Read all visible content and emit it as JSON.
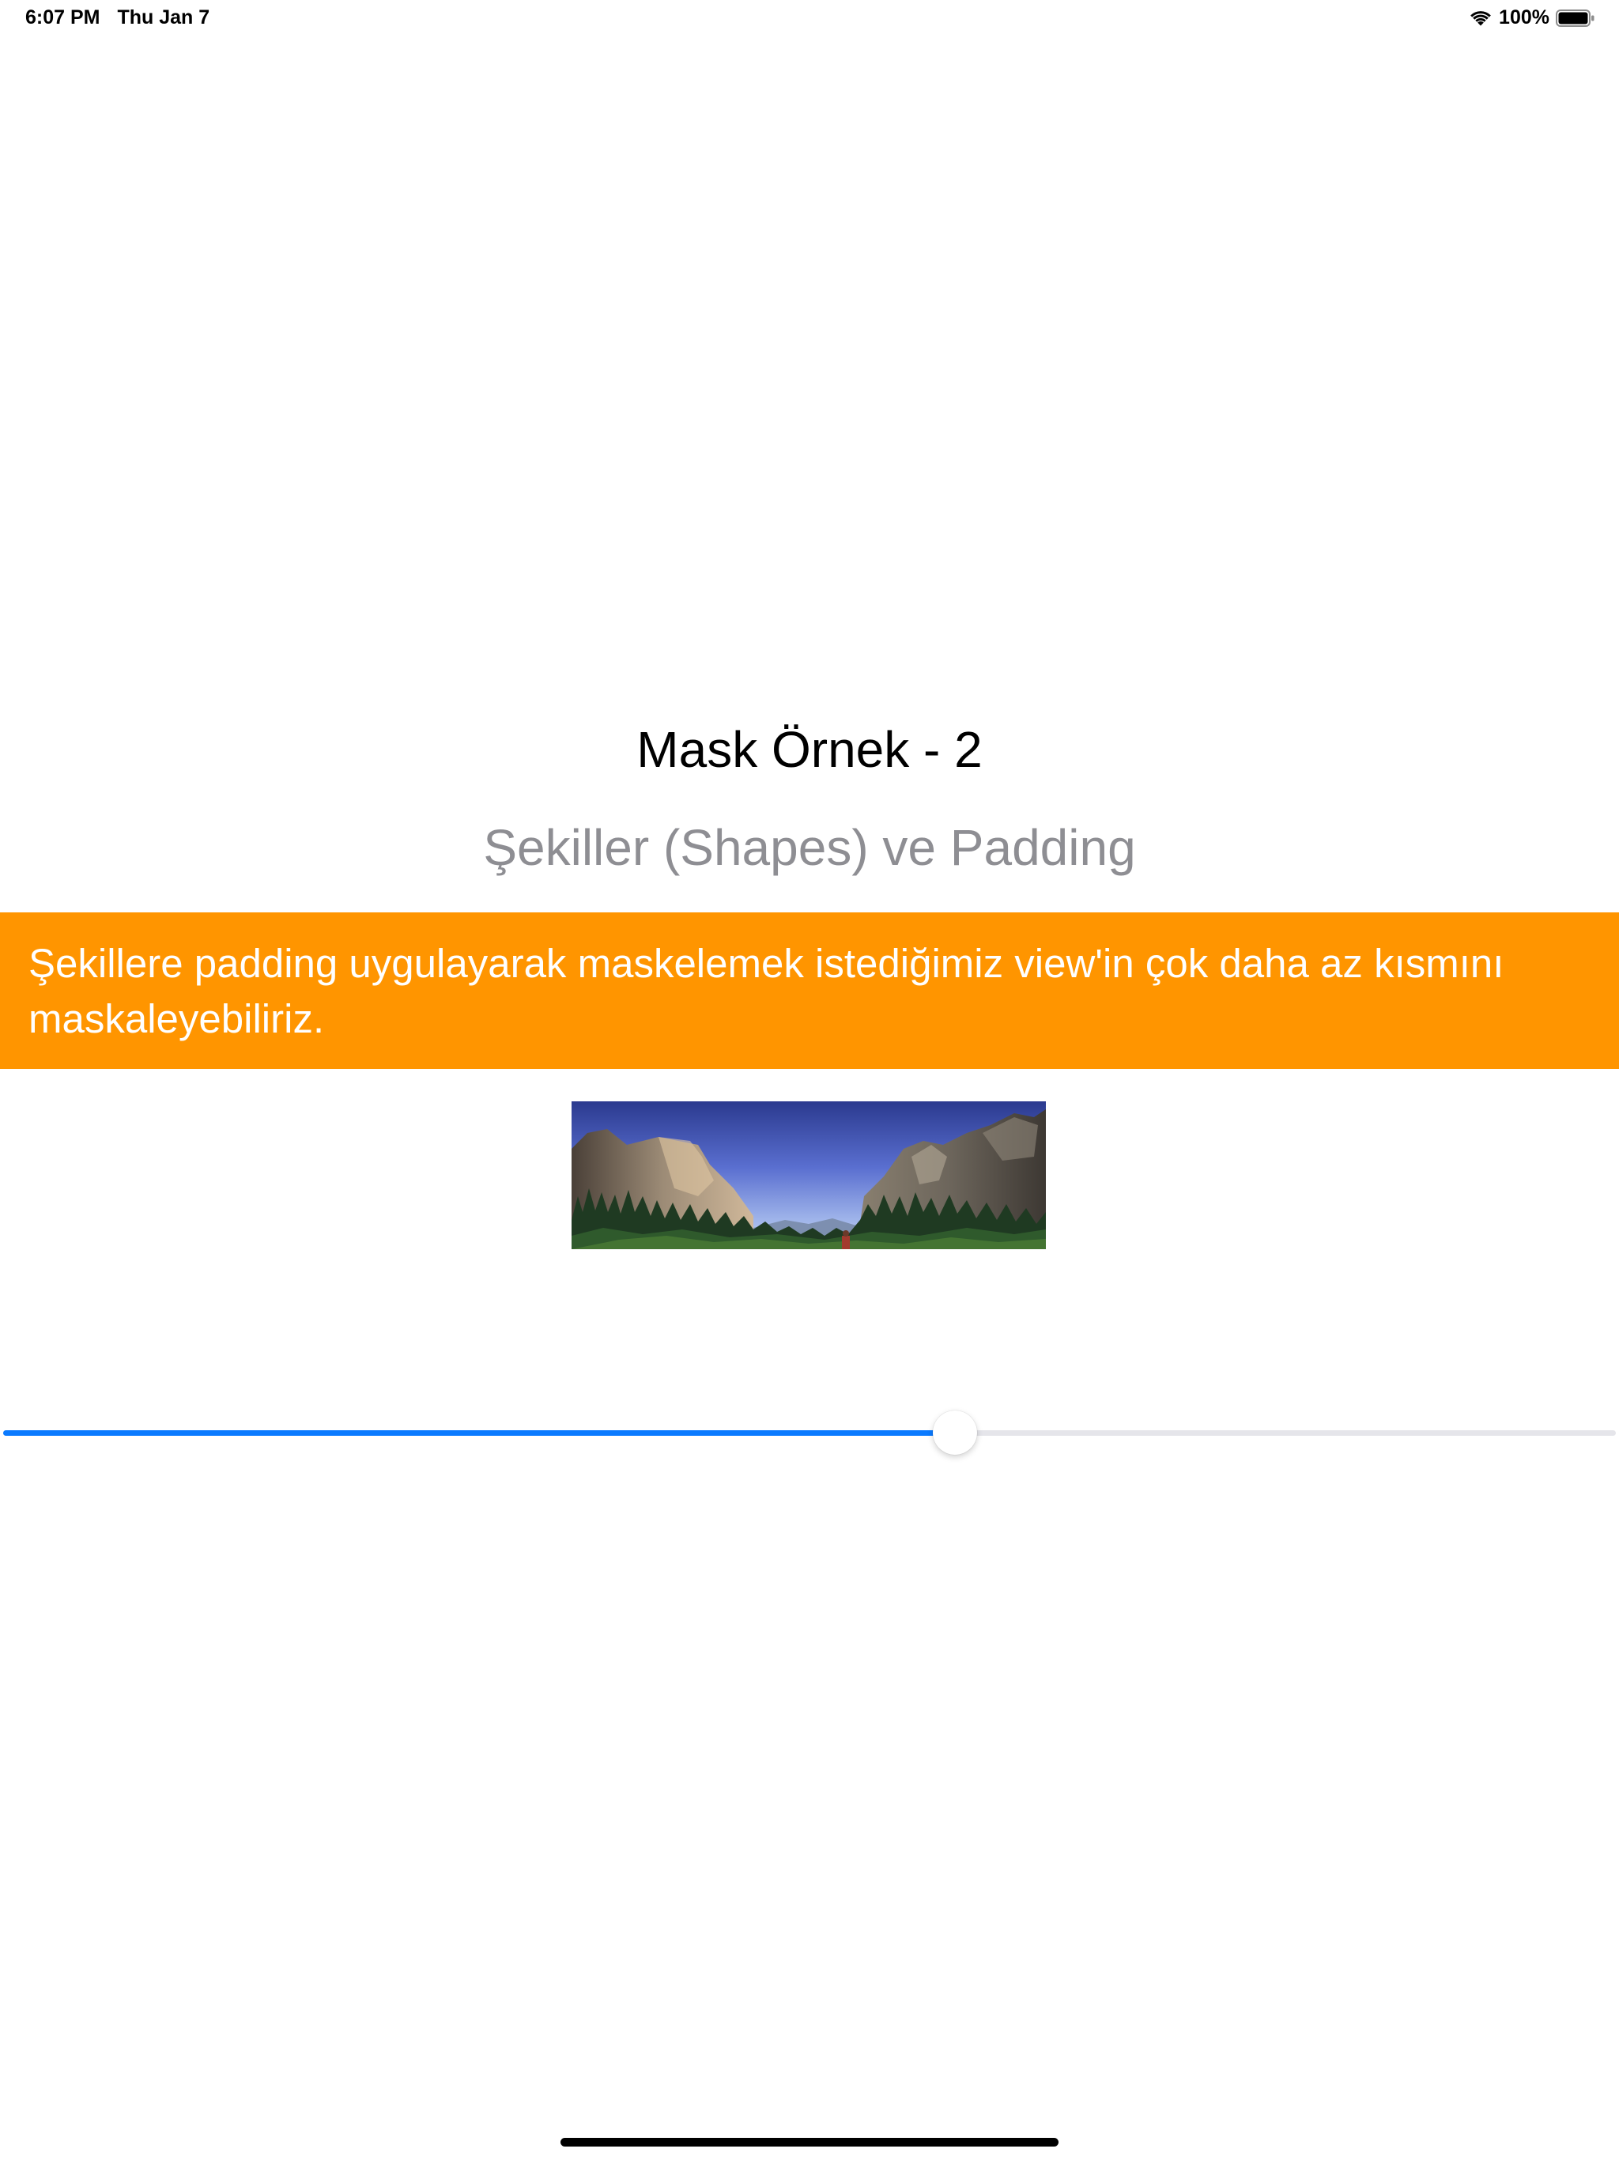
{
  "status_bar": {
    "time": "6:07 PM",
    "date": "Thu Jan 7",
    "battery": "100%",
    "wifi_icon": "wifi-icon",
    "battery_icon": "battery-icon"
  },
  "content": {
    "title": "Mask Örnek - 2",
    "subtitle": "Şekiller (Shapes) ve Padding",
    "banner_text": "Şekillere padding uygulayarak maskelemek istediğimiz view'in çok daha az kısmını maskaleyebiliriz.",
    "banner_color": "#ff9500",
    "image": "landscape-photo"
  },
  "slider": {
    "value": 0.59,
    "tint": "#0a7aff",
    "track": "#e5e5ea"
  }
}
